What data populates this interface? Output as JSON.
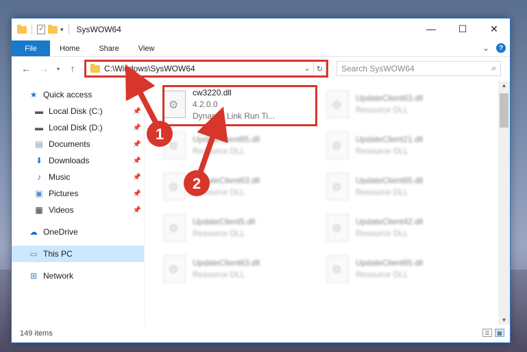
{
  "window": {
    "title": "SysWOW64",
    "caption": {
      "minimize": "—",
      "maximize": "☐",
      "close": "✕"
    }
  },
  "ribbon": {
    "tabs": [
      "File",
      "Home",
      "Share",
      "View"
    ],
    "expand_glyph": "⌄",
    "help_glyph": "?"
  },
  "address": {
    "path": "C:\\Windows\\SysWOW64",
    "search_placeholder": "Search SysWOW64"
  },
  "sidebar": {
    "items": [
      {
        "label": "Quick access",
        "icon": "star-icon",
        "glyph": "★",
        "color": "#2b79d0"
      },
      {
        "label": "Local Disk (C:)",
        "icon": "drive-icon",
        "glyph": "▬",
        "color": "#555555"
      },
      {
        "label": "Local Disk (D:)",
        "icon": "drive-icon",
        "glyph": "▬",
        "color": "#555555"
      },
      {
        "label": "Documents",
        "icon": "documents-icon",
        "glyph": "▤",
        "color": "#6d8fb8"
      },
      {
        "label": "Downloads",
        "icon": "downloads-icon",
        "glyph": "⬇",
        "color": "#2b79d0"
      },
      {
        "label": "Music",
        "icon": "music-icon",
        "glyph": "♪",
        "color": "#2b79d0"
      },
      {
        "label": "Pictures",
        "icon": "pictures-icon",
        "glyph": "▣",
        "color": "#4f8fcf"
      },
      {
        "label": "Videos",
        "icon": "videos-icon",
        "glyph": "▦",
        "color": "#333333"
      },
      {
        "label": "OneDrive",
        "icon": "onedrive-icon",
        "glyph": "☁",
        "color": "#1f6fc5"
      },
      {
        "label": "This PC",
        "icon": "pc-icon",
        "glyph": "▭",
        "color": "#3b8ad8"
      },
      {
        "label": "Network",
        "icon": "network-icon",
        "glyph": "⊞",
        "color": "#3b8ad8"
      }
    ],
    "pin_glyph": "📌"
  },
  "files": {
    "highlighted": {
      "name": "cw3220.dll",
      "version": "4.2.0.0",
      "description": "Dynamic Link Run Ti..."
    },
    "left_column": [
      {
        "name": "UpdateClient65.dll",
        "type": "Resource DLL"
      },
      {
        "name": "UpdateClient63.dll",
        "type": "Resource DLL"
      },
      {
        "name": "UpdateClient5.dll",
        "type": "Resource DLL"
      },
      {
        "name": "UpdateClient63.dll",
        "type": "Resource DLL"
      }
    ],
    "right_column": [
      {
        "name": "UpdateClient63.dll",
        "type": "Resource DLL"
      },
      {
        "name": "UpdateClient21.dll",
        "type": "Resource DLL"
      },
      {
        "name": "UpdateClient65.dll",
        "type": "Resource DLL"
      },
      {
        "name": "UpdateClient42.dll",
        "type": "Resource DLL"
      },
      {
        "name": "UpdateClient65.dll",
        "type": "Resource DLL"
      }
    ]
  },
  "status": {
    "count": "149 items"
  },
  "annotations": {
    "step1": "1",
    "step2": "2",
    "color": "#d8352b"
  }
}
